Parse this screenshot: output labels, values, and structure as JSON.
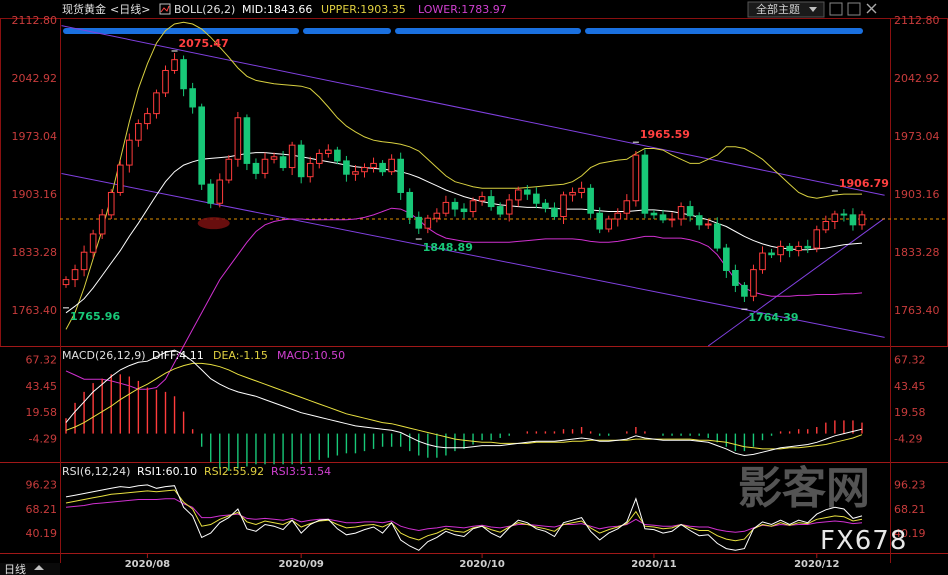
{
  "header": {
    "symbol": "现货黄金",
    "period": "<日线>",
    "boll_label": "BOLL(26,2)",
    "mid_label": "MID:1843.66",
    "upper_label": "UPPER:1903.35",
    "lower_label": "LOWER:1783.97",
    "theme_select": "全部主题"
  },
  "bottom_bar": {
    "period_tab": "日线"
  },
  "watermark": {
    "logo_text": "影客网",
    "brand": "FX678"
  },
  "colors": {
    "up": "#ff3c3c",
    "down": "#18c878",
    "mid": "#ffffff",
    "upper": "#d8d040",
    "lower": "#d030d0",
    "channel": "#8040e0",
    "level": "#e09000",
    "diff": "#ffffff",
    "dea": "#e8e040",
    "rsi1": "#ffffff",
    "rsi2": "#e8e040",
    "rsi3": "#d030d0"
  },
  "chart_data": [
    {
      "id": "price",
      "type": "candlestick",
      "y_ticks": [
        "2112.80",
        "2042.92",
        "1973.04",
        "1903.16",
        "1833.28",
        "1763.40"
      ],
      "ylim": [
        1720,
        2112.8
      ],
      "x_labels": [
        "2020/08",
        "2020/09",
        "2020/10",
        "2020/11",
        "2020/12"
      ],
      "x_label_index": [
        9,
        26,
        46,
        65,
        83
      ],
      "reference_level": 1873,
      "annotations": [
        {
          "text": "2075.47",
          "index": 12,
          "value": 2075.47,
          "color": "#ff4040"
        },
        {
          "text": "1765.96",
          "index": 0,
          "value": 1765.96,
          "color": "#18c878"
        },
        {
          "text": "1848.89",
          "index": 39,
          "value": 1848.89,
          "color": "#18c878"
        },
        {
          "text": "1965.59",
          "index": 63,
          "value": 1965.59,
          "color": "#ff4040"
        },
        {
          "text": "1764.39",
          "index": 75,
          "value": 1764.39,
          "color": "#18c878"
        },
        {
          "text": "1906.79",
          "index": 85,
          "value": 1906.79,
          "color": "#ff4040"
        }
      ],
      "close": [
        1800,
        1812,
        1833,
        1855,
        1878,
        1905,
        1938,
        1968,
        1988,
        2000,
        2025,
        2052,
        2065,
        2030,
        2008,
        1915,
        1892,
        1920,
        1945,
        1995,
        1940,
        1928,
        1945,
        1948,
        1935,
        1962,
        1924,
        1940,
        1952,
        1956,
        1943,
        1927,
        1930,
        1935,
        1940,
        1930,
        1945,
        1905,
        1875,
        1862,
        1874,
        1880,
        1893,
        1885,
        1882,
        1895,
        1900,
        1888,
        1879,
        1896,
        1908,
        1903,
        1892,
        1886,
        1876,
        1902,
        1905,
        1910,
        1880,
        1861,
        1873,
        1880,
        1895,
        1950,
        1880,
        1878,
        1872,
        1873,
        1888,
        1877,
        1866,
        1867,
        1838,
        1811,
        1793,
        1780,
        1812,
        1832,
        1830,
        1840,
        1835,
        1840,
        1838,
        1860,
        1870,
        1879,
        1878,
        1866,
        1878
      ],
      "ma_mid": [
        1760,
        1768,
        1777,
        1790,
        1805,
        1820,
        1835,
        1852,
        1868,
        1885,
        1902,
        1918,
        1930,
        1938,
        1942,
        1945,
        1946,
        1947,
        1948,
        1950,
        1952,
        1953,
        1953,
        1952,
        1951,
        1950,
        1948,
        1946,
        1944,
        1942,
        1940,
        1938,
        1936,
        1935,
        1934,
        1933,
        1932,
        1930,
        1927,
        1923,
        1918,
        1913,
        1908,
        1904,
        1900,
        1897,
        1894,
        1892,
        1890,
        1889,
        1888,
        1887,
        1887,
        1886,
        1886,
        1885,
        1885,
        1885,
        1884,
        1883,
        1882,
        1882,
        1882,
        1883,
        1884,
        1884,
        1883,
        1882,
        1880,
        1878,
        1875,
        1872,
        1868,
        1864,
        1858,
        1852,
        1847,
        1843,
        1840,
        1838,
        1837,
        1836,
        1836,
        1837,
        1838,
        1840,
        1842,
        1843,
        1844
      ],
      "ma_upper": [
        1740,
        1760,
        1790,
        1825,
        1860,
        1900,
        1945,
        1990,
        2030,
        2060,
        2085,
        2100,
        2108,
        2110,
        2108,
        2102,
        2092,
        2080,
        2068,
        2055,
        2045,
        2040,
        2038,
        2036,
        2035,
        2034,
        2033,
        2030,
        2020,
        2008,
        1995,
        1985,
        1978,
        1972,
        1968,
        1966,
        1965,
        1963,
        1960,
        1955,
        1945,
        1935,
        1925,
        1918,
        1915,
        1912,
        1910,
        1910,
        1910,
        1910,
        1910,
        1911,
        1912,
        1913,
        1914,
        1915,
        1918,
        1925,
        1935,
        1940,
        1942,
        1944,
        1945,
        1952,
        1958,
        1958,
        1956,
        1950,
        1945,
        1940,
        1940,
        1945,
        1950,
        1960,
        1960,
        1958,
        1952,
        1945,
        1935,
        1925,
        1915,
        1905,
        1900,
        1898,
        1900,
        1902,
        1903,
        1903,
        1903
      ],
      "ma_lower": [
        1690,
        1685,
        1680,
        1680,
        1680,
        1678,
        1675,
        1672,
        1668,
        1668,
        1670,
        1680,
        1700,
        1720,
        1740,
        1760,
        1780,
        1800,
        1815,
        1830,
        1845,
        1858,
        1866,
        1870,
        1872,
        1873,
        1873,
        1872,
        1872,
        1872,
        1872,
        1872,
        1873,
        1875,
        1878,
        1882,
        1886,
        1885,
        1880,
        1872,
        1862,
        1855,
        1850,
        1848,
        1846,
        1845,
        1845,
        1845,
        1845,
        1845,
        1846,
        1847,
        1848,
        1849,
        1849,
        1849,
        1849,
        1848,
        1846,
        1845,
        1845,
        1846,
        1848,
        1850,
        1852,
        1852,
        1850,
        1850,
        1850,
        1848,
        1845,
        1840,
        1830,
        1815,
        1800,
        1790,
        1785,
        1782,
        1780,
        1780,
        1780,
        1781,
        1781,
        1782,
        1782,
        1782,
        1783,
        1783,
        1784
      ]
    },
    {
      "id": "macd",
      "type": "histogram",
      "label": "MACD(26,12,9)",
      "diff_label": "DIFF:4.11",
      "dea_label": "DEA:-1.15",
      "macd_label": "MACD:10.50",
      "y_ticks": [
        "67.32",
        "43.45",
        "19.58",
        "-4.29"
      ],
      "ylim": [
        -25,
        78
      ],
      "diff": [
        10,
        20,
        29,
        38,
        45,
        52,
        58,
        62,
        65,
        66,
        70,
        74,
        76,
        72,
        66,
        58,
        50,
        45,
        41,
        38,
        36,
        34,
        31,
        28,
        25,
        22,
        19,
        17,
        15,
        13,
        11,
        9,
        7,
        6,
        5,
        4,
        3,
        1,
        -3,
        -7,
        -10,
        -12,
        -13,
        -13,
        -13,
        -12,
        -11,
        -11,
        -11,
        -10,
        -9,
        -8,
        -7,
        -7,
        -7,
        -6,
        -5,
        -4,
        -5,
        -7,
        -7,
        -6,
        -5,
        -2,
        -4,
        -5,
        -6,
        -6,
        -6,
        -6,
        -7,
        -8,
        -11,
        -14,
        -18,
        -20,
        -19,
        -17,
        -15,
        -13,
        -12,
        -11,
        -10,
        -8,
        -5,
        -2,
        0,
        2,
        4
      ],
      "dea": [
        3,
        6,
        10,
        15,
        20,
        25,
        31,
        36,
        41,
        45,
        50,
        55,
        59,
        62,
        64,
        64,
        63,
        61,
        58,
        54,
        51,
        48,
        45,
        42,
        39,
        36,
        33,
        30,
        27,
        24,
        21,
        18,
        16,
        14,
        12,
        10,
        9,
        7,
        5,
        3,
        1,
        -1,
        -3,
        -5,
        -6,
        -7,
        -8,
        -8,
        -9,
        -9,
        -9,
        -9,
        -8,
        -8,
        -8,
        -8,
        -7,
        -7,
        -6,
        -6,
        -6,
        -6,
        -6,
        -5,
        -5,
        -5,
        -5,
        -5,
        -5,
        -5,
        -6,
        -6,
        -7,
        -8,
        -10,
        -12,
        -13,
        -14,
        -14,
        -14,
        -13,
        -13,
        -12,
        -11,
        -10,
        -8,
        -6,
        -4,
        -1
      ]
    },
    {
      "id": "rsi",
      "type": "line",
      "label": "RSI(6,12,24)",
      "rsi1_label": "RSI1:60.10",
      "rsi2_label": "RSI2:55.92",
      "rsi3_label": "RSI3:51.54",
      "y_ticks": [
        "96.23",
        "68.21",
        "40.19"
      ],
      "ylim": [
        18,
        104
      ],
      "rsi1": [
        82,
        84,
        86,
        88,
        90,
        92,
        94,
        93,
        95,
        96,
        92,
        94,
        95,
        70,
        60,
        35,
        40,
        52,
        58,
        68,
        45,
        42,
        50,
        48,
        44,
        55,
        40,
        50,
        55,
        56,
        45,
        38,
        40,
        44,
        47,
        40,
        52,
        32,
        25,
        20,
        30,
        35,
        42,
        38,
        36,
        45,
        48,
        40,
        35,
        46,
        55,
        52,
        45,
        42,
        36,
        52,
        55,
        58,
        42,
        32,
        40,
        45,
        53,
        80,
        45,
        44,
        40,
        42,
        50,
        43,
        37,
        38,
        28,
        22,
        20,
        22,
        45,
        53,
        50,
        55,
        50,
        55,
        52,
        62,
        67,
        70,
        68,
        57,
        60
      ],
      "rsi2": [
        75,
        77,
        79,
        81,
        83,
        85,
        86,
        87,
        88,
        89,
        88,
        89,
        90,
        76,
        68,
        48,
        50,
        56,
        60,
        64,
        53,
        50,
        54,
        52,
        50,
        55,
        47,
        51,
        54,
        55,
        50,
        46,
        47,
        49,
        50,
        47,
        52,
        40,
        35,
        32,
        37,
        40,
        45,
        42,
        41,
        46,
        48,
        44,
        41,
        47,
        52,
        50,
        47,
        45,
        42,
        50,
        52,
        54,
        46,
        40,
        44,
        47,
        51,
        65,
        48,
        47,
        45,
        46,
        50,
        46,
        43,
        43,
        37,
        33,
        31,
        33,
        45,
        50,
        48,
        52,
        49,
        52,
        51,
        56,
        58,
        60,
        59,
        54,
        56
      ],
      "rsi3": [
        70,
        71,
        72,
        74,
        75,
        76,
        77,
        78,
        79,
        79,
        79,
        80,
        80,
        74,
        70,
        58,
        58,
        60,
        61,
        62,
        57,
        56,
        57,
        56,
        55,
        57,
        53,
        55,
        56,
        56,
        54,
        52,
        52,
        53,
        53,
        52,
        54,
        48,
        45,
        43,
        45,
        46,
        48,
        47,
        46,
        48,
        49,
        47,
        46,
        48,
        50,
        50,
        49,
        48,
        47,
        50,
        50,
        51,
        48,
        45,
        47,
        48,
        50,
        56,
        50,
        49,
        48,
        48,
        50,
        48,
        47,
        47,
        44,
        42,
        41,
        42,
        46,
        49,
        48,
        50,
        49,
        50,
        50,
        52,
        53,
        54,
        53,
        51,
        52
      ]
    }
  ]
}
